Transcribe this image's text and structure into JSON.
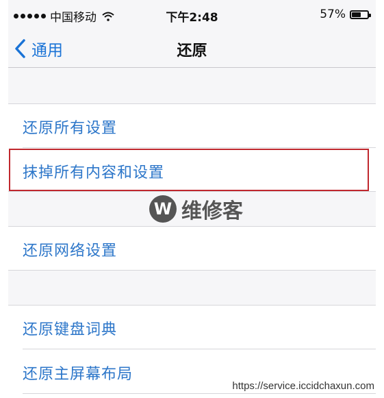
{
  "status_bar": {
    "carrier": "中国移动",
    "time": "下午2:48",
    "battery_percent": "57%",
    "battery_level": 0.57,
    "signal_icon": "signal-dots-icon",
    "wifi_icon": "wifi-icon"
  },
  "nav": {
    "back_label": "通用",
    "back_icon": "chevron-left-icon",
    "title": "还原"
  },
  "items": [
    {
      "label": "还原所有设置"
    },
    {
      "label": "抹掉所有内容和设置"
    },
    {
      "label": "还原网络设置"
    },
    {
      "label": "还原键盘词典"
    },
    {
      "label": "还原主屏幕布局"
    }
  ],
  "colors": {
    "accent": "#2c76c9",
    "highlight_border": "#c0272d",
    "background": "#f6f6f8"
  },
  "watermark": {
    "logo_letter": "W",
    "text": "维修客"
  },
  "footer_url": "https://service.iccidchaxun.com"
}
